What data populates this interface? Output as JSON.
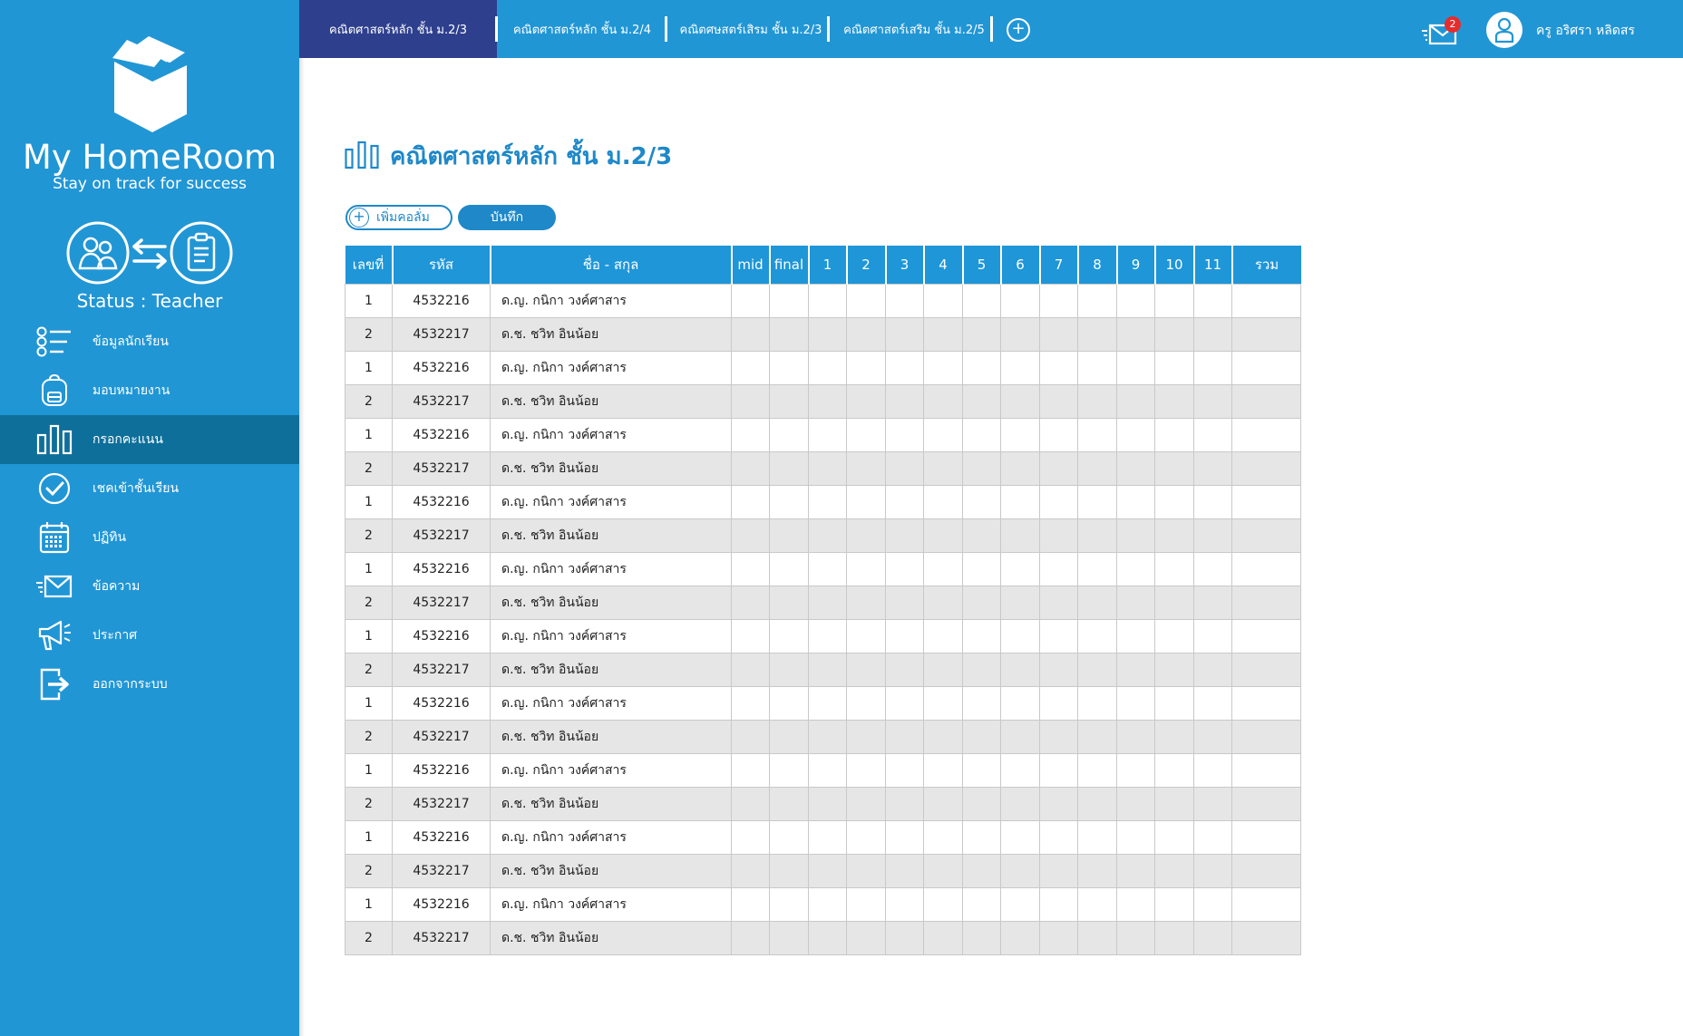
{
  "app": {
    "name": "My HomeRoom",
    "tagline": "Stay on track for success",
    "status": "Status : Teacher"
  },
  "sidebar": {
    "items": [
      {
        "label": "ข้อมูลนักเรียน",
        "icon": "student-list-icon",
        "active": false
      },
      {
        "label": "มอบหมายงาน",
        "icon": "backpack-icon",
        "active": false
      },
      {
        "label": "กรอกคะแนน",
        "icon": "bar-chart-icon",
        "active": true
      },
      {
        "label": "เชคเข้าชั้นเรียน",
        "icon": "check-circle-icon",
        "active": false
      },
      {
        "label": "ปฏิทิน",
        "icon": "calendar-icon",
        "active": false
      },
      {
        "label": "ข้อความ",
        "icon": "mail-icon",
        "active": false
      },
      {
        "label": "ประกาศ",
        "icon": "megaphone-icon",
        "active": false
      },
      {
        "label": "ออกจากระบบ",
        "icon": "logout-icon",
        "active": false
      }
    ]
  },
  "header": {
    "tabs": [
      {
        "label": "คณิตศาสตร์หลัก ชั้น ม.2/3",
        "active": true
      },
      {
        "label": "คณิตศาสตร์หลัก ชั้น ม.2/4",
        "active": false
      },
      {
        "label": "คณิตศษสตร์เสิรม ชั้น ม.2/3",
        "active": false
      },
      {
        "label": "คณิตศาสตร์เสริม ชั้น ม.2/5",
        "active": false
      }
    ],
    "add_tab": "+",
    "mail_count": "2",
    "user_name": "ครู อริศรา หลิดสร"
  },
  "main": {
    "title": "คณิตศาสตร์หลัก ชั้น ม.2/3",
    "add_column_label": "เพิ่มคอลั่ม",
    "add_column_plus": "+",
    "save_label": "บันทึก"
  },
  "table": {
    "headers": [
      "เลขที่",
      "รหัส",
      "ชื่อ - สกุล",
      "mid",
      "final",
      "1",
      "2",
      "3",
      "4",
      "5",
      "6",
      "7",
      "8",
      "9",
      "10",
      "11",
      "รวม"
    ],
    "rows": [
      {
        "no": "1",
        "id": "4532216",
        "name": "ด.ญ. กนิกา วงค์ศาสาร"
      },
      {
        "no": "2",
        "id": "4532217",
        "name": "ด.ช. ชวิท อินน้อย"
      },
      {
        "no": "1",
        "id": "4532216",
        "name": "ด.ญ. กนิกา วงค์ศาสาร"
      },
      {
        "no": "2",
        "id": "4532217",
        "name": "ด.ช. ชวิท อินน้อย"
      },
      {
        "no": "1",
        "id": "4532216",
        "name": "ด.ญ. กนิกา วงค์ศาสาร"
      },
      {
        "no": "2",
        "id": "4532217",
        "name": "ด.ช. ชวิท อินน้อย"
      },
      {
        "no": "1",
        "id": "4532216",
        "name": "ด.ญ. กนิกา วงค์ศาสาร"
      },
      {
        "no": "2",
        "id": "4532217",
        "name": "ด.ช. ชวิท อินน้อย"
      },
      {
        "no": "1",
        "id": "4532216",
        "name": "ด.ญ. กนิกา วงค์ศาสาร"
      },
      {
        "no": "2",
        "id": "4532217",
        "name": "ด.ช. ชวิท อินน้อย"
      },
      {
        "no": "1",
        "id": "4532216",
        "name": "ด.ญ. กนิกา วงค์ศาสาร"
      },
      {
        "no": "2",
        "id": "4532217",
        "name": "ด.ช. ชวิท อินน้อย"
      },
      {
        "no": "1",
        "id": "4532216",
        "name": "ด.ญ. กนิกา วงค์ศาสาร"
      },
      {
        "no": "2",
        "id": "4532217",
        "name": "ด.ช. ชวิท อินน้อย"
      },
      {
        "no": "1",
        "id": "4532216",
        "name": "ด.ญ. กนิกา วงค์ศาสาร"
      },
      {
        "no": "2",
        "id": "4532217",
        "name": "ด.ช. ชวิท อินน้อย"
      },
      {
        "no": "1",
        "id": "4532216",
        "name": "ด.ญ. กนิกา วงค์ศาสาร"
      },
      {
        "no": "2",
        "id": "4532217",
        "name": "ด.ช. ชวิท อินน้อย"
      },
      {
        "no": "1",
        "id": "4532216",
        "name": "ด.ญ. กนิกา วงค์ศาสาร"
      },
      {
        "no": "2",
        "id": "4532217",
        "name": "ด.ช. ชวิท อินน้อย"
      }
    ]
  },
  "colors": {
    "primary": "#2196d5",
    "active_tab": "#2e3f8e",
    "active_menu": "#0e6f9a",
    "accent": "#1e88c9",
    "badge": "#e52d2d",
    "row_alt": "#e6e6e7"
  }
}
